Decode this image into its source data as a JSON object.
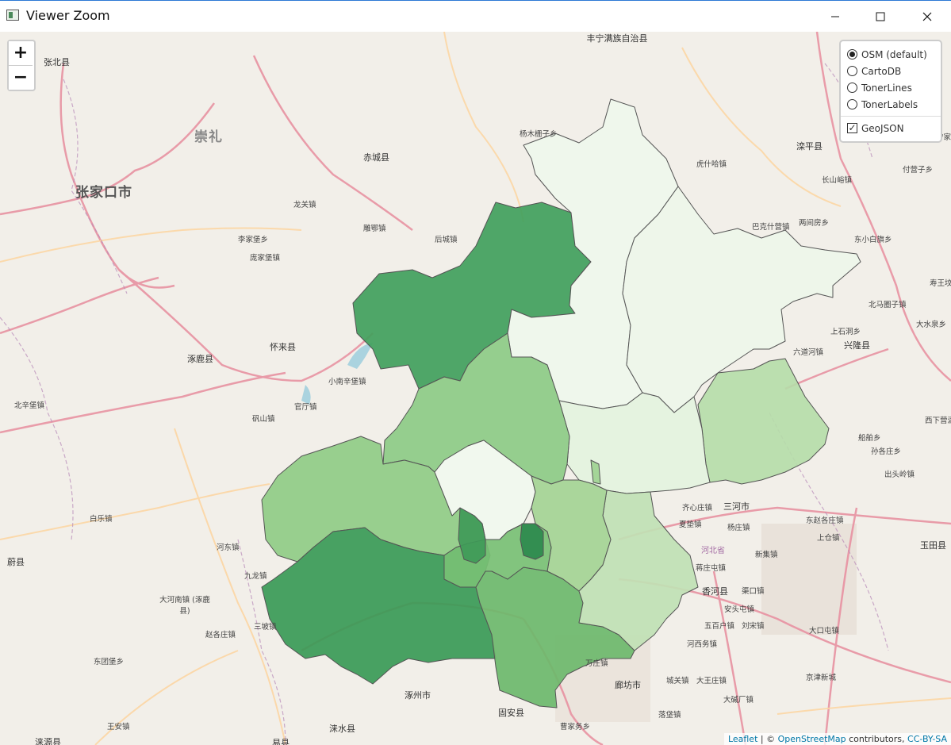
{
  "window": {
    "title": "Viewer Zoom",
    "minimize_icon": "minimize-icon",
    "maximize_icon": "maximize-icon",
    "close_icon": "close-icon"
  },
  "zoom": {
    "in_label": "+",
    "out_label": "−"
  },
  "layers": {
    "base": [
      {
        "label": "OSM (default)",
        "selected": true
      },
      {
        "label": "CartoDB",
        "selected": false
      },
      {
        "label": "TonerLines",
        "selected": false
      },
      {
        "label": "TonerLabels",
        "selected": false
      }
    ],
    "overlay": {
      "label": "GeoJSON",
      "checked": true
    }
  },
  "attribution": {
    "leaflet": "Leaflet",
    "sep": " | © ",
    "osm": "OpenStreetMap",
    "contrib": " contributors, ",
    "license": "CC-BY-SA"
  },
  "colors": {
    "map_bg": "#f2efe9",
    "choropleth_darkest": "#2e8b4f",
    "choropleth_light": "#e8f4e6",
    "motorway": "#e892a2",
    "primary": "#fcd6a4"
  },
  "place_labels": {
    "zhangbei": "张北县",
    "chongli": "崇礼",
    "zhangjiakou": "张家口市",
    "chicheng": "赤城县",
    "fengning": "丰宁满族自治县",
    "longguan": "龙关镇",
    "diaoe": "雕鄂镇",
    "houcheng": "后城镇",
    "lijiapu": "李家堡乡",
    "pangjiapu": "庞家堡镇",
    "zhuolu": "涿鹿县",
    "huailai": "怀来县",
    "xiaonanxinpu": "小南辛堡镇",
    "beixinpu": "北辛堡镇",
    "guanting": "官厅镇",
    "fanshan": "矾山镇",
    "baileqi": "白乐镇",
    "hedong": "河东镇",
    "yuxian": "蔚县",
    "jiulong": "九龙镇",
    "dahenan": "大河南镇 (涿鹿县)",
    "sanpo": "三坡镇",
    "zhaogezhuang": "赵各庄镇",
    "dongtuanpu": "东团堡乡",
    "wanganzhen": "王安镇",
    "laiyuan": "涞源县",
    "yixian": "易县",
    "zhuozhou": "涿州市",
    "laishui": "涞水县",
    "guan": "固安县",
    "caojia": "曹家务乡",
    "langfang": "廊坊市",
    "wanzhuang": "万庄镇",
    "luopo": "落垡镇",
    "chengguan": "城关镇",
    "dawangzhuang": "大王庄镇",
    "dajianchang": "大碱厂镇",
    "xianghe": "香河县",
    "qixinzhuang": "齐心庄镇",
    "sanhe": "三河市",
    "xiadian": "夏垫镇",
    "yangzhuang": "杨庄镇",
    "hebei": "河北省",
    "jiangzhuang": "蒋庄屯镇",
    "qukou": "渠口镇",
    "anxiutun": "安头屯镇",
    "wubaihu": "五百户镇",
    "liusong": "刘宋镇",
    "hexiwu": "河西务镇",
    "dakou": "大口屯镇",
    "jingjin": "京津新城",
    "xindian": "新集镇",
    "shanghe": "上仓镇",
    "dongzhao": "东赵各庄镇",
    "yutian": "玉田县",
    "chuanfang": "船舶乡",
    "sunge": "孙各庄乡",
    "chutou": "出头岭镇",
    "xixia": "西下营满族乡",
    "yangmu": "杨木栅子乡",
    "luanping": "滦平县",
    "hushi": "虎什哈镇",
    "changshan": "长山峪镇",
    "fuyingzi": "付营子乡",
    "bakeshi": "巴克什营镇",
    "liangjian": "两间房乡",
    "dongxiao": "东小白旗乡",
    "beimaquan": "北马圈子镇",
    "shangshi": "上石洞乡",
    "xinglong": "兴隆县",
    "liudao": "六道河镇",
    "dahe": "大水泉乡",
    "shouwang": "寿王坟镇",
    "ningjiang": "宁家营"
  }
}
